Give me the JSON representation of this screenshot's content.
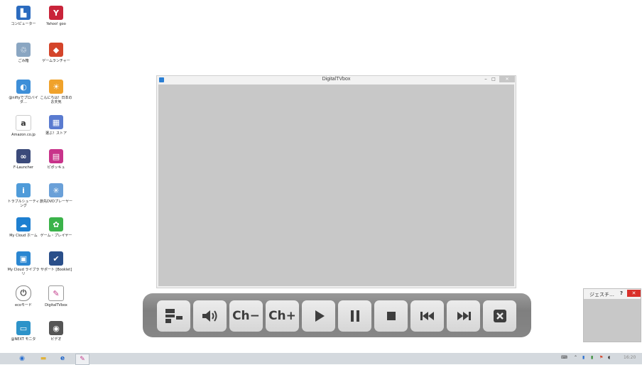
{
  "desktop_icons": [
    {
      "label": "コンピューター",
      "glyph": "▙",
      "color": "#2b6bbf"
    },
    {
      "label": "Yahoo! goo",
      "glyph": "Y",
      "color": "#c9243a"
    },
    {
      "label": "ごみ箱",
      "glyph": "♲",
      "color": "#8aa6c2"
    },
    {
      "label": "ゲームランチャー",
      "glyph": "◆",
      "color": "#d4442a"
    },
    {
      "label": "@niftyでプロバイダ…",
      "glyph": "◐",
      "color": "#3e8fd8"
    },
    {
      "label": "こんにちは！日本のお天気",
      "glyph": "☀",
      "color": "#f0a22b"
    },
    {
      "label": "Amazon.co.jp",
      "glyph": "a",
      "color": "#333333"
    },
    {
      "label": "選ぶ！ストア",
      "glyph": "▦",
      "color": "#5a7bd0"
    },
    {
      "label": "F-Launcher",
      "glyph": "∞",
      "color": "#3b4a7a"
    },
    {
      "label": "ピポッキュ",
      "glyph": "▤",
      "color": "#c8338a"
    },
    {
      "label": "トラブルシューティング",
      "glyph": "i",
      "color": "#4f9bd9"
    },
    {
      "label": "旅先DVDプレーヤー",
      "glyph": "✳",
      "color": "#6aa0d8"
    },
    {
      "label": "My Cloud ホーム",
      "glyph": "☁",
      "color": "#1e7fd0"
    },
    {
      "label": "ゲーム・プレイヤー",
      "glyph": "✿",
      "color": "#3bb34a"
    },
    {
      "label": "My Cloud ライブラリ",
      "glyph": "▣",
      "color": "#2a86d1"
    },
    {
      "label": "サポート [Booklet]",
      "glyph": "✔",
      "color": "#2a4f8a"
    },
    {
      "label": "ecoモード",
      "glyph": "⏻",
      "color": "#444444"
    },
    {
      "label": "DigitalTVbox",
      "glyph": "✎",
      "color": "#c23a8a"
    },
    {
      "label": "@NEXT モニタ",
      "glyph": "▭",
      "color": "#2d93c9"
    },
    {
      "label": "ビデオ",
      "glyph": "◉",
      "color": "#555555"
    }
  ],
  "window": {
    "title": "DigitalTVbox",
    "min_symbol": "–",
    "max_symbol": "□",
    "close_symbol": "✕"
  },
  "controls": {
    "ch_down": "Ch−",
    "ch_up": "Ch+"
  },
  "gesture": {
    "title": "ジェスチ…",
    "help": "?",
    "close": "✕"
  },
  "taskbar": {
    "start_glyph": "◉",
    "explorer_glyph": "▬",
    "ie_glyph": "e",
    "app_glyph": "✎",
    "clock": "16:20"
  }
}
